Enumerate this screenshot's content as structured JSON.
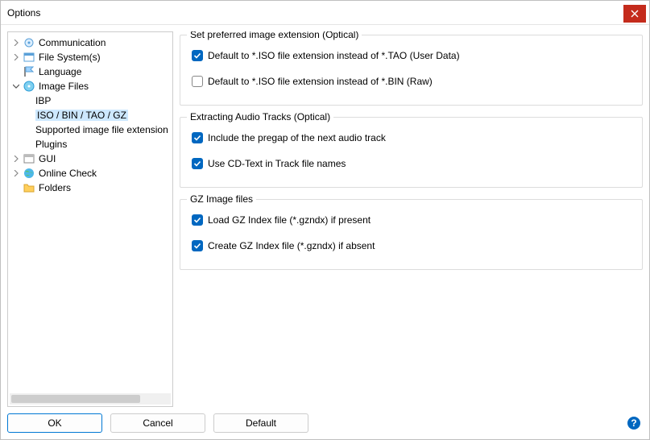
{
  "window": {
    "title": "Options"
  },
  "tree": {
    "items": {
      "communication": "Communication",
      "filesystems": "File System(s)",
      "language": "Language",
      "imagefiles": "Image Files",
      "ibp": "IBP",
      "isobin": "ISO / BIN / TAO / GZ",
      "supported": "Supported image file extension",
      "plugins": "Plugins",
      "gui": "GUI",
      "onlinecheck": "Online Check",
      "folders": "Folders"
    }
  },
  "groups": {
    "g1": {
      "legend": "Set preferred image extension (Optical)",
      "opt1": "Default to *.ISO file extension instead of *.TAO (User Data)",
      "opt2": "Default to *.ISO file extension instead of *.BIN (Raw)"
    },
    "g2": {
      "legend": "Extracting Audio Tracks (Optical)",
      "opt1": "Include the pregap of the next audio track",
      "opt2": "Use CD-Text in Track file names"
    },
    "g3": {
      "legend": "GZ Image files",
      "opt1": "Load GZ Index file (*.gzndx) if present",
      "opt2": "Create GZ Index file (*.gzndx) if absent"
    }
  },
  "footer": {
    "ok": "OK",
    "cancel": "Cancel",
    "default": "Default"
  },
  "checked": {
    "g1_1": true,
    "g1_2": false,
    "g2_1": true,
    "g2_2": true,
    "g3_1": true,
    "g3_2": true
  }
}
